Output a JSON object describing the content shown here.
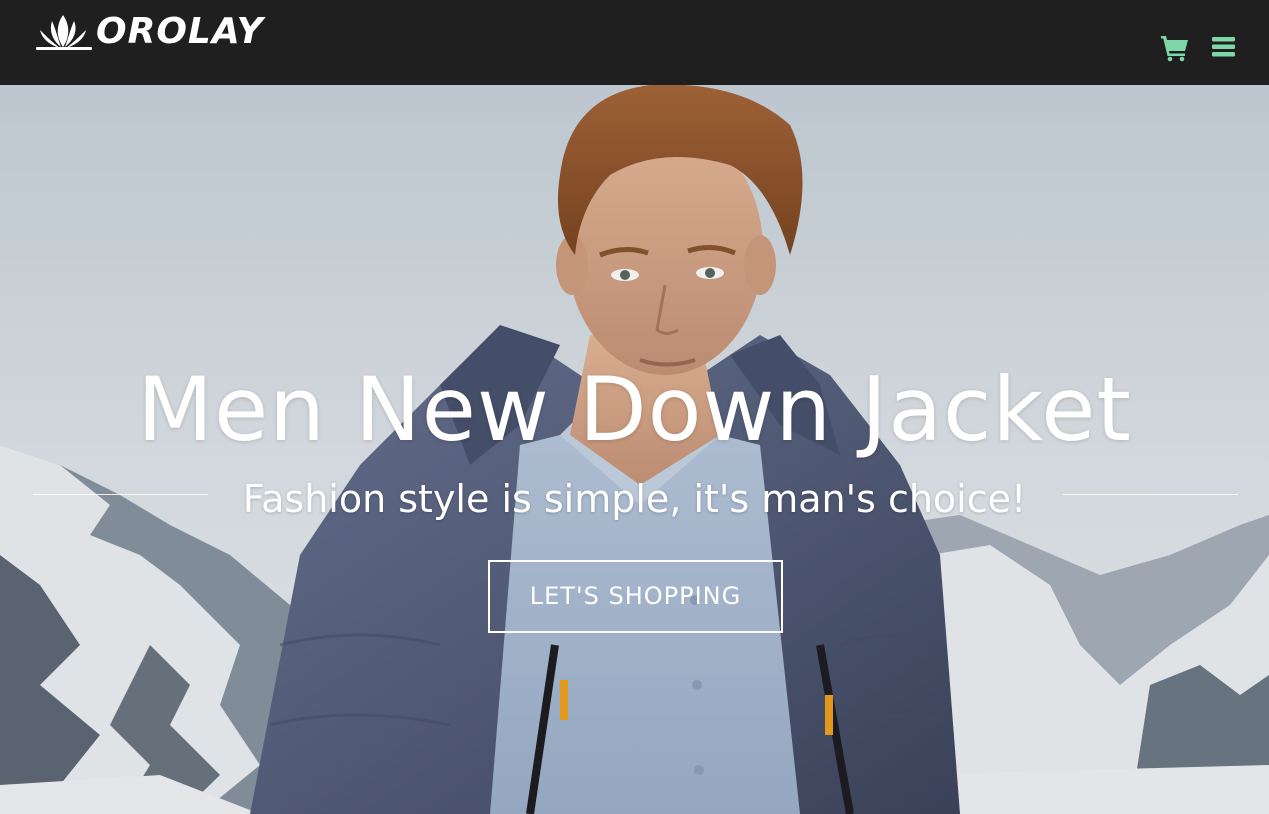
{
  "brand": {
    "name": "OROLAY"
  },
  "header": {
    "icons": {
      "cart": "shopping-cart-icon",
      "menu": "hamburger-menu-icon"
    },
    "colors": {
      "background": "#1f1f1f",
      "icon_accent": "#7fd6a8"
    }
  },
  "hero": {
    "title": "Men New Down Jacket",
    "subtitle": "Fashion style is simple, it's man's choice!",
    "cta_label": "LET'S SHOPPING"
  }
}
